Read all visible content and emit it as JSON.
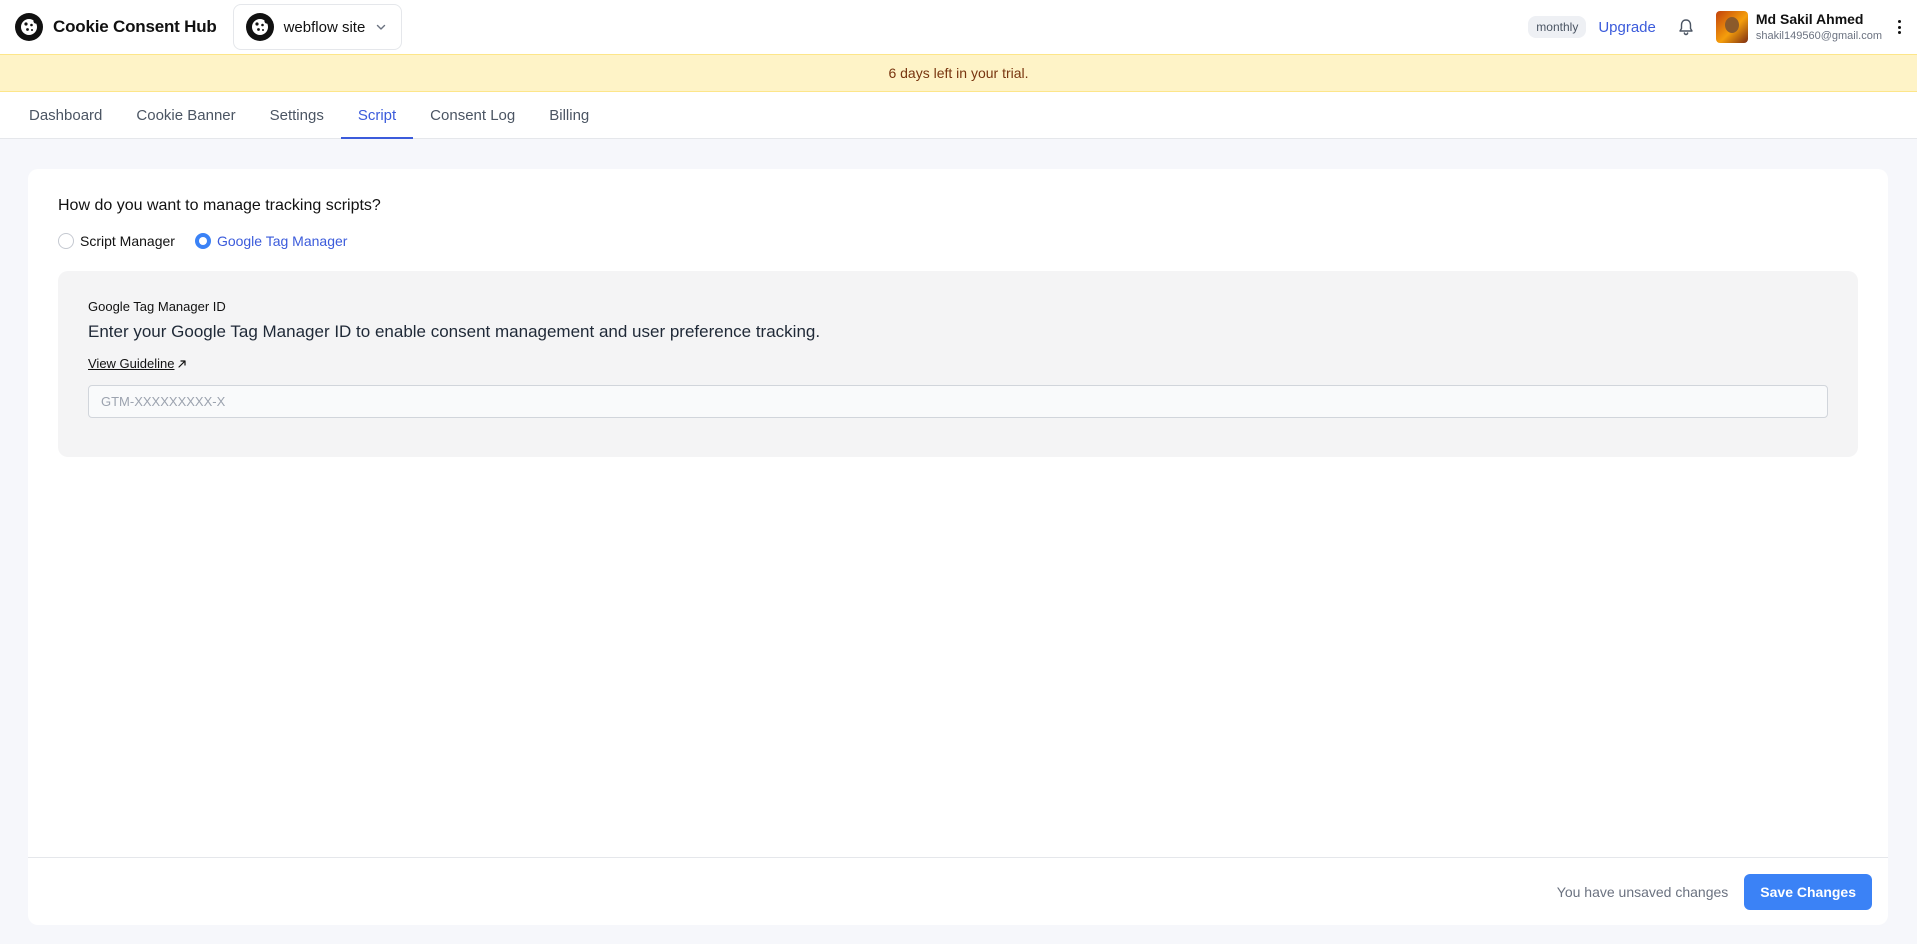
{
  "header": {
    "brand_name": "Cookie Consent Hub",
    "site_name": "webflow site",
    "plan_badge": "monthly",
    "upgrade_label": "Upgrade",
    "user": {
      "name": "Md Sakil Ahmed",
      "email": "shakil149560@gmail.com"
    }
  },
  "trial_banner": "6 days left in your trial.",
  "tabs": [
    {
      "label": "Dashboard",
      "active": false
    },
    {
      "label": "Cookie Banner",
      "active": false
    },
    {
      "label": "Settings",
      "active": false
    },
    {
      "label": "Script",
      "active": true
    },
    {
      "label": "Consent Log",
      "active": false
    },
    {
      "label": "Billing",
      "active": false
    }
  ],
  "script": {
    "question": "How do you want to manage tracking scripts?",
    "options": [
      {
        "label": "Script Manager",
        "checked": false
      },
      {
        "label": "Google Tag Manager",
        "checked": true
      }
    ],
    "gtm": {
      "label": "Google Tag Manager ID",
      "description": "Enter your Google Tag Manager ID to enable consent management and user preference tracking.",
      "guideline_label": "View Guideline",
      "input_value": "",
      "input_placeholder": "GTM-XXXXXXXXX-X"
    }
  },
  "footer": {
    "unsaved_text": "You have unsaved changes",
    "save_label": "Save Changes"
  },
  "colors": {
    "accent": "#3b5bdb",
    "button": "#3b82f6",
    "trial_bg": "#fef3c7",
    "trial_text": "#78350f"
  }
}
